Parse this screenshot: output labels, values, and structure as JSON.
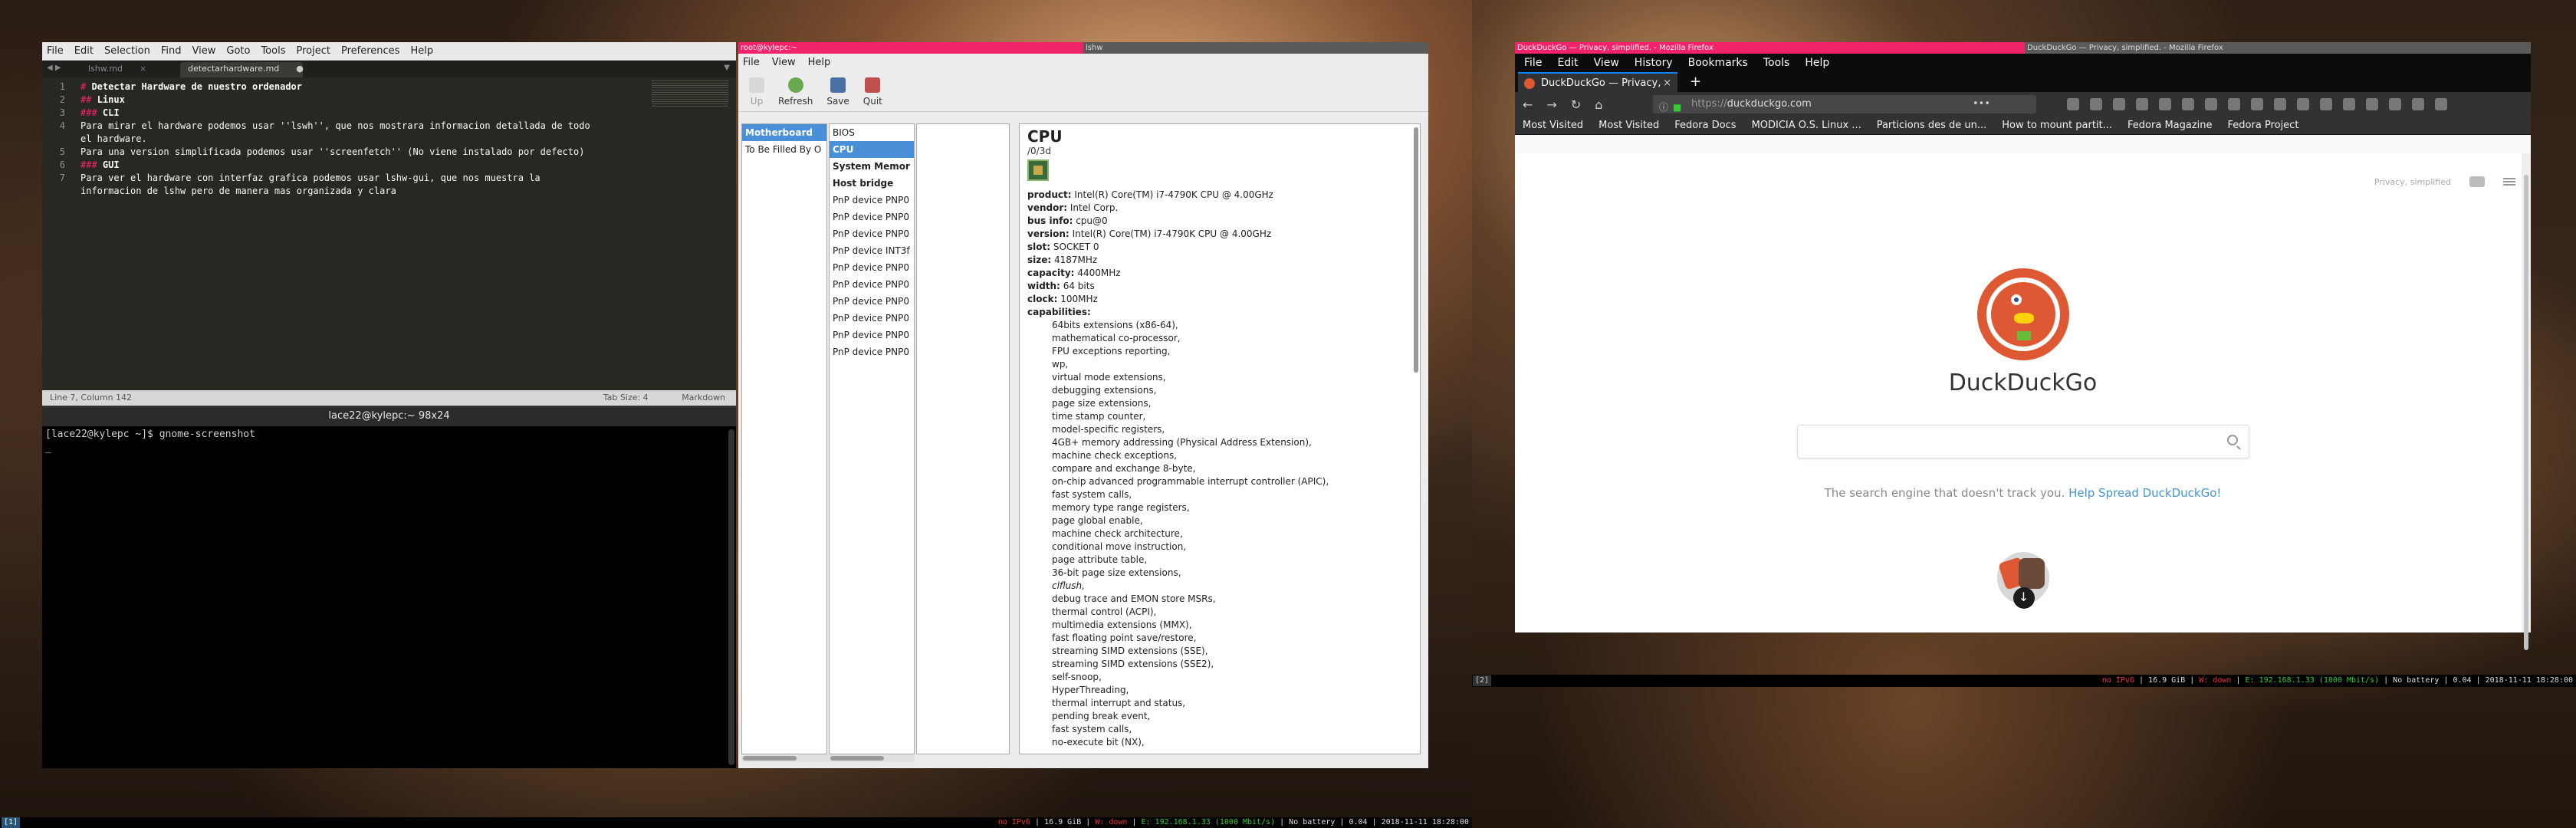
{
  "sublime": {
    "menu": [
      "File",
      "Edit",
      "Selection",
      "Find",
      "View",
      "Goto",
      "Tools",
      "Project",
      "Preferences",
      "Help"
    ],
    "tabs": [
      "lshw.md",
      "detectarhardware.md"
    ],
    "line_numbers": [
      "1",
      "2",
      "3",
      "4",
      "",
      "5",
      "6",
      "7",
      ""
    ],
    "lines": [
      {
        "hash": "# ",
        "text": "Detectar Hardware de nuestro ordenador",
        "heading": true
      },
      {
        "hash": "## ",
        "text": "Linux",
        "heading": true
      },
      {
        "hash": "### ",
        "text": "CLI",
        "heading": true
      },
      {
        "hash": "",
        "text": "Para mirar el hardware podemos usar ''lswh'', que nos mostrara informacion detallada de todo",
        "heading": false
      },
      {
        "hash": "",
        "text": "el hardware.",
        "heading": false
      },
      {
        "hash": "",
        "text": "Para una version simplificada podemos usar ''screenfetch'' (No viene instalado por defecto)",
        "heading": false
      },
      {
        "hash": "### ",
        "text": "GUI",
        "heading": true
      },
      {
        "hash": "",
        "text": "Para ver el hardware con interfaz grafica podemos usar lshw-gui, que nos muestra la",
        "heading": false
      },
      {
        "hash": "",
        "text": "informacion de lshw pero de manera mas organizada y clara",
        "heading": false
      }
    ],
    "status": {
      "position": "Line 7, Column 142",
      "tab_size": "Tab Size: 4",
      "syntax": "Markdown"
    }
  },
  "terminal": {
    "title": "lace22@kylepc:~ 98x24",
    "prompt": "[lace22@kylepc ~]$ gnome-screenshot",
    "cursor": "_"
  },
  "lshw": {
    "title_active": "root@kylepc:~",
    "title_other": "lshw",
    "menu": [
      "File",
      "View",
      "Help"
    ],
    "toolbar": [
      "Up",
      "Refresh",
      "Save",
      "Quit"
    ],
    "pane1": [
      "Motherboard",
      "To Be Filled By O"
    ],
    "pane2": [
      "BIOS",
      "CPU",
      "System Memor",
      "Host bridge",
      "PnP device PNP0",
      "PnP device PNP0",
      "PnP device PNP0",
      "PnP device INT3f",
      "PnP device PNP0",
      "PnP device PNP0",
      "PnP device PNP0",
      "PnP device PNP0",
      "PnP device PNP0",
      "PnP device PNP0"
    ],
    "detail": {
      "heading": "CPU",
      "path": "/0/3d",
      "props": [
        {
          "k": "product:",
          "v": "Intel(R) Core(TM) i7-4790K CPU @ 4.00GHz"
        },
        {
          "k": "vendor:",
          "v": "Intel Corp."
        },
        {
          "k": "bus info:",
          "v": "cpu@0"
        },
        {
          "k": "version:",
          "v": "Intel(R) Core(TM) i7-4790K CPU @ 4.00GHz"
        },
        {
          "k": "slot:",
          "v": "SOCKET 0"
        },
        {
          "k": "size:",
          "v": "4187MHz"
        },
        {
          "k": "capacity:",
          "v": "4400MHz"
        },
        {
          "k": "width:",
          "v": "64 bits"
        },
        {
          "k": "clock:",
          "v": "100MHz"
        },
        {
          "k": "capabilities:",
          "v": ""
        }
      ],
      "capabilities": [
        "64bits extensions (x86-64),",
        "mathematical co-processor,",
        "FPU exceptions reporting,",
        "wp,",
        "virtual mode extensions,",
        "debugging extensions,",
        "page size extensions,",
        "time stamp counter,",
        "model-specific registers,",
        "4GB+ memory addressing (Physical Address Extension),",
        "machine check exceptions,",
        "compare and exchange 8-byte,",
        "on-chip advanced programmable interrupt controller (APIC),",
        "fast system calls,",
        "memory type range registers,",
        "page global enable,",
        "machine check architecture,",
        "conditional move instruction,",
        "page attribute table,",
        "36-bit page size extensions,",
        "clflush,",
        "debug trace and EMON store MSRs,",
        "thermal control (ACPI),",
        "multimedia extensions (MMX),",
        "fast floating point save/restore,",
        "streaming SIMD extensions (SSE),",
        "streaming SIMD extensions (SSE2),",
        "self-snoop,",
        "HyperThreading,",
        "thermal interrupt and status,",
        "pending break event,",
        "fast system calls,",
        "no-execute bit (NX),"
      ]
    }
  },
  "firefox": {
    "title_active": "DuckDuckGo — Privacy, simplified. - Mozilla Firefox",
    "title_other": "DuckDuckGo — Privacy, simplified. - Mozilla Firefox",
    "menu": [
      "File",
      "Edit",
      "View",
      "History",
      "Bookmarks",
      "Tools",
      "Help"
    ],
    "tab_title": "DuckDuckGo — Privacy,",
    "url_prefix": "https://",
    "url_host": "duckduckgo.com",
    "bookmarks": [
      "Most Visited",
      "Most Visited",
      "Fedora Docs",
      "MODICIA O.S. Linux ...",
      "Particions des de un...",
      "How to mount partit...",
      "Fedora Magazine",
      "Fedora Project"
    ],
    "ddg": {
      "privacy_label": "Privacy, simplified",
      "name": "DuckDuckGo",
      "tagline": "The search engine that doesn't track you.",
      "tagline_link": "Help Spread DuckDuckGo!"
    }
  },
  "status_left": {
    "workspace": "[1]",
    "ipv6": "no IPv6",
    "mem": "16.9 GiB",
    "wifi": "W: down",
    "eth": "E: 192.168.1.33 (1000 Mbit/s)",
    "battery": "No battery",
    "load": "0.04",
    "datetime": "2018-11-11 18:28:00"
  },
  "status_right": {
    "workspace": "[2]",
    "ipv6": "no IPv6",
    "mem": "16.9 GiB",
    "wifi": "W: down",
    "eth": "E: 192.168.1.33 (1000 Mbit/s)",
    "battery": "No battery",
    "load": "0.04",
    "datetime": "2018-11-11 18:28:00"
  }
}
